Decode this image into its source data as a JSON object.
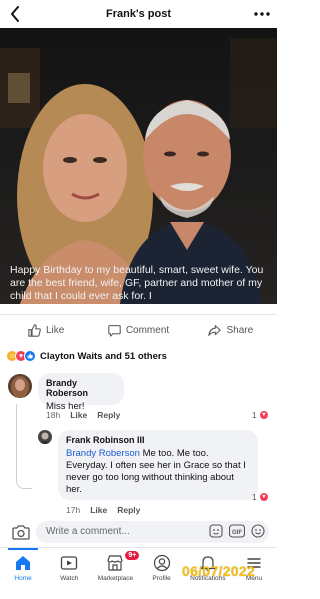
{
  "header": {
    "title": "Frank's post",
    "back_icon": "chevron-left-icon",
    "more_icon": "ellipsis-icon"
  },
  "post": {
    "caption": "Happy Birthday to my beautiful, smart, sweet wife.  You are the best friend, wife, GF, partner and mother of my child that I could ever ask for. I"
  },
  "actions": {
    "like": "Like",
    "comment": "Comment",
    "share": "Share"
  },
  "reactions": {
    "summary": "Clayton Waits and 51 others"
  },
  "comments": [
    {
      "author": "Brandy Roberson",
      "text": "Miss her!",
      "time": "18h",
      "like": "Like",
      "reply": "Reply",
      "heart_count": "1"
    },
    {
      "author": "Frank Robinson III",
      "mention": "Brandy Roberson",
      "text": " Me too. Me too. Everyday. I often see her in Grace so that I never go too long without thinking about her.",
      "time": "17h",
      "like": "Like",
      "reply": "Reply",
      "heart_count": "1"
    }
  ],
  "composer": {
    "placeholder": "Write a comment..."
  },
  "nav": {
    "items": [
      {
        "label": "Home",
        "icon": "home-icon",
        "active": true
      },
      {
        "label": "Watch",
        "icon": "watch-icon"
      },
      {
        "label": "Marketplace",
        "icon": "marketplace-icon",
        "badge": "9+"
      },
      {
        "label": "Profile",
        "icon": "profile-icon"
      },
      {
        "label": "Notifications",
        "icon": "bell-icon"
      },
      {
        "label": "Menu",
        "icon": "menu-icon"
      }
    ]
  },
  "watermark": "06/07/2022",
  "colors": {
    "accent": "#1877f2",
    "mention": "#1b5bd1",
    "badge": "#e41e3f",
    "watermark": "#f5c010"
  }
}
